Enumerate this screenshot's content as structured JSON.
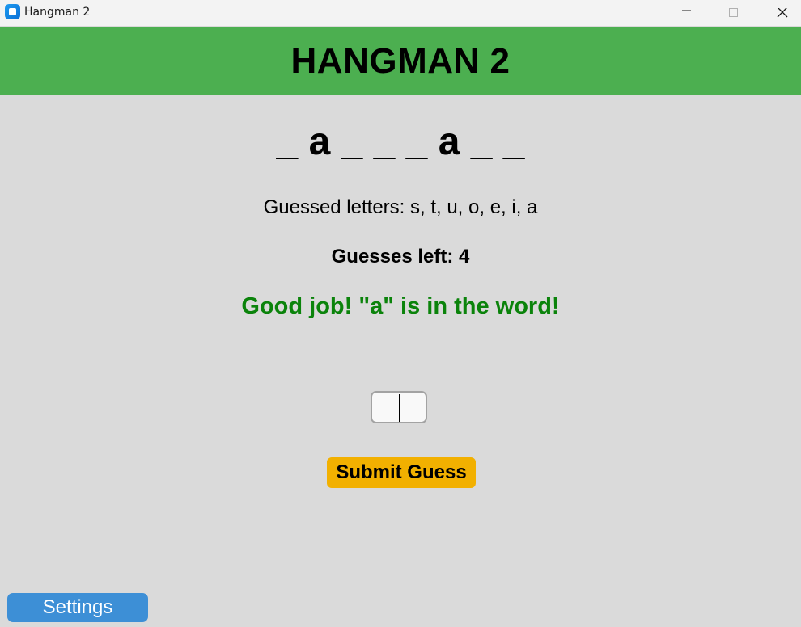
{
  "window": {
    "title": "Hangman 2",
    "icon": "app-icon"
  },
  "header": {
    "title": "HANGMAN 2",
    "background": "#4caf50"
  },
  "game": {
    "word_display": "_ a _ _ _ a _ _",
    "guessed_letters": "Guessed letters: s, t, u, o, e, i, a",
    "guesses_left": "Guesses left: 4",
    "feedback": "Good job! \"a\" is in the word!",
    "feedback_color": "#0b830b"
  },
  "input": {
    "value": "",
    "placeholder": ""
  },
  "buttons": {
    "submit_label": "Submit Guess",
    "submit_color": "#f2b000",
    "settings_label": "Settings",
    "settings_color": "#3d8fd6"
  }
}
